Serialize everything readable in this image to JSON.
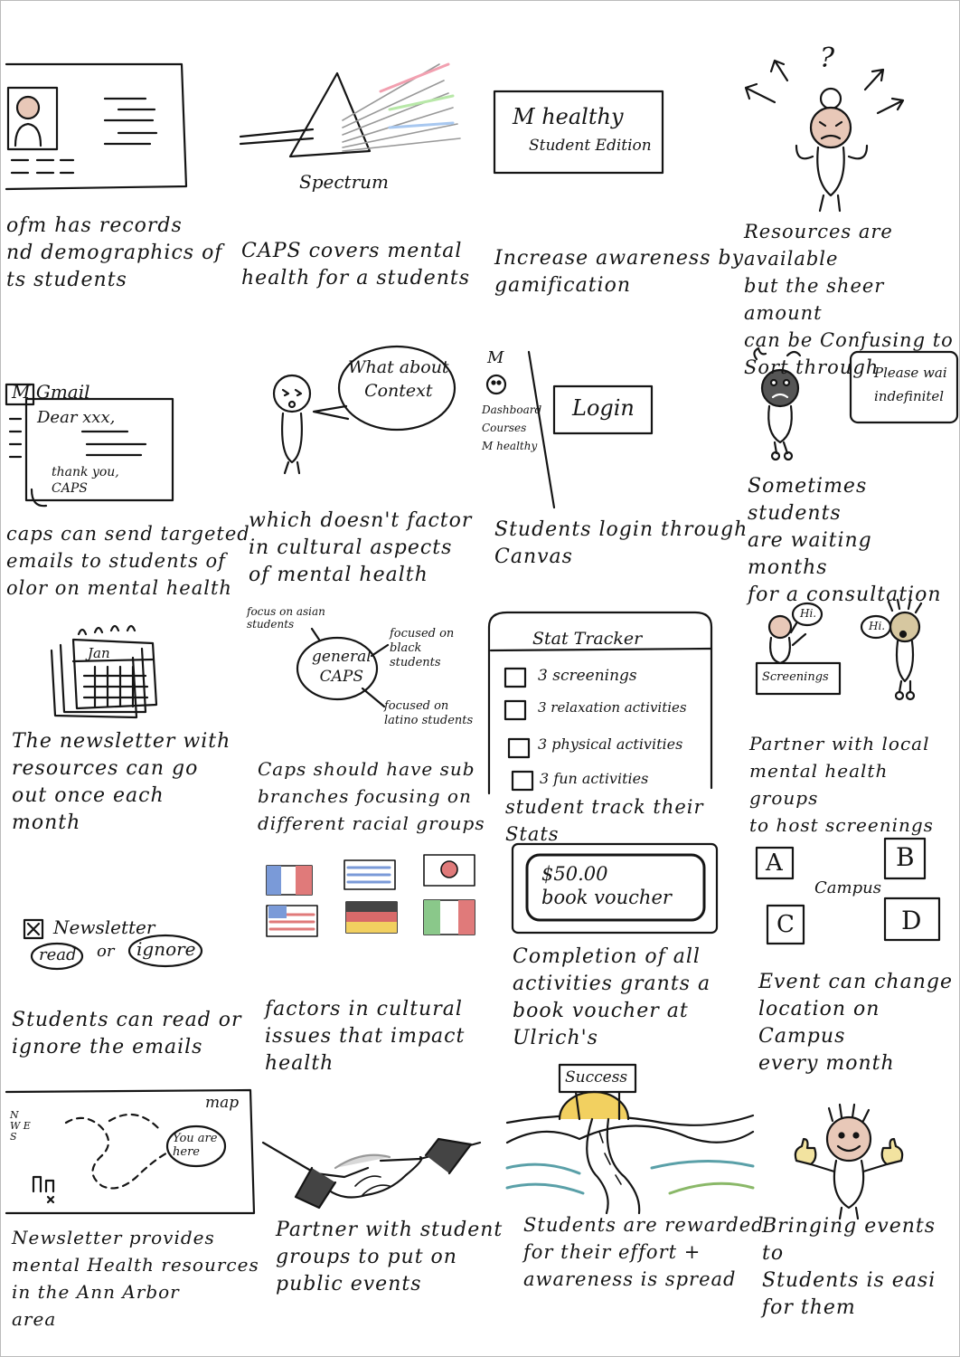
{
  "panels": [
    {
      "caption": "ofm has records\nnd demographics of\nts students"
    },
    {
      "caption": "CAPS covers mental\nhealth for a students",
      "label": "Spectrum"
    },
    {
      "caption": "Increase awareness by\ngamification",
      "box_title": "M healthy",
      "box_subtitle": "Student Edition"
    },
    {
      "caption": "Resources are available\nbut the sheer amount\ncan be Confusing to\nSort through",
      "mark": "?"
    },
    {
      "caption": "caps can send targeted\nemails to students of\nolor on mental health",
      "app": "M Gmail",
      "email_greeting": "Dear xxx,",
      "email_signoff": "thank you,\nCAPS"
    },
    {
      "caption": "which doesn't factor\nin cultural aspects\nof mental health",
      "speech": "What about\nContext"
    },
    {
      "caption": "Students login through\nCanvas",
      "logo": "M",
      "nav": [
        "Dashboard",
        "Courses",
        "M healthy"
      ],
      "button": "Login"
    },
    {
      "caption": "Sometimes students\nare waiting months\nfor a consultation",
      "sign": "Please wai\nindefinitel"
    },
    {
      "caption": "The newsletter with\nresources can go\nout once each\nmonth",
      "calendar_month": "Jan"
    },
    {
      "caption": "Caps should have sub\nbranches focusing on\ndifferent racial groups",
      "center": "general\nCAPS",
      "branches": [
        "focus on asian\nstudents",
        "focused on\nblack\nstudents",
        "focused on\nlatino students"
      ]
    },
    {
      "caption": "student track their\nStats",
      "title": "Stat Tracker",
      "items": [
        "3 screenings",
        "3 relaxation activities",
        "3 physical activities",
        "3 fun activities"
      ]
    },
    {
      "caption": "Partner with local\nmental health groups\nto host screenings",
      "greeting": "Hi.",
      "greeting2": "Hi.",
      "booth": "Screenings"
    },
    {
      "caption": "Students can read or\nignore the emails",
      "checkbox_label": "Newsletter",
      "read": "read",
      "or": "or",
      "ignore": "ignore"
    },
    {
      "caption": "factors in cultural\nissues that impact\nhealth"
    },
    {
      "caption": "Completion of all\nactivities grants a\nbook voucher at\nUlrich's",
      "voucher": "$50.00\nbook voucher"
    },
    {
      "caption": "Event can change\nlocation on Campus\nevery month",
      "center": "Campus",
      "locations": [
        "A",
        "B",
        "C",
        "D"
      ]
    },
    {
      "caption": "Newsletter provides\nmental Health resources\nin the Ann Arbor\narea",
      "map_title": "map",
      "compass": "N\nW E\nS",
      "marker": "You are\nhere"
    },
    {
      "caption": "Partner with student\ngroups to put on\npublic events"
    },
    {
      "caption": "Students are rewarded\nfor their effort +\nawareness is spread",
      "sign": "Success"
    },
    {
      "caption": "Bringing events to\nStudents is easi\nfor them"
    }
  ],
  "colors": {
    "ink": "#151515",
    "skin": "#e8c8b8",
    "face_tan": "#d6c7a0",
    "voucher_border": "#333333"
  }
}
